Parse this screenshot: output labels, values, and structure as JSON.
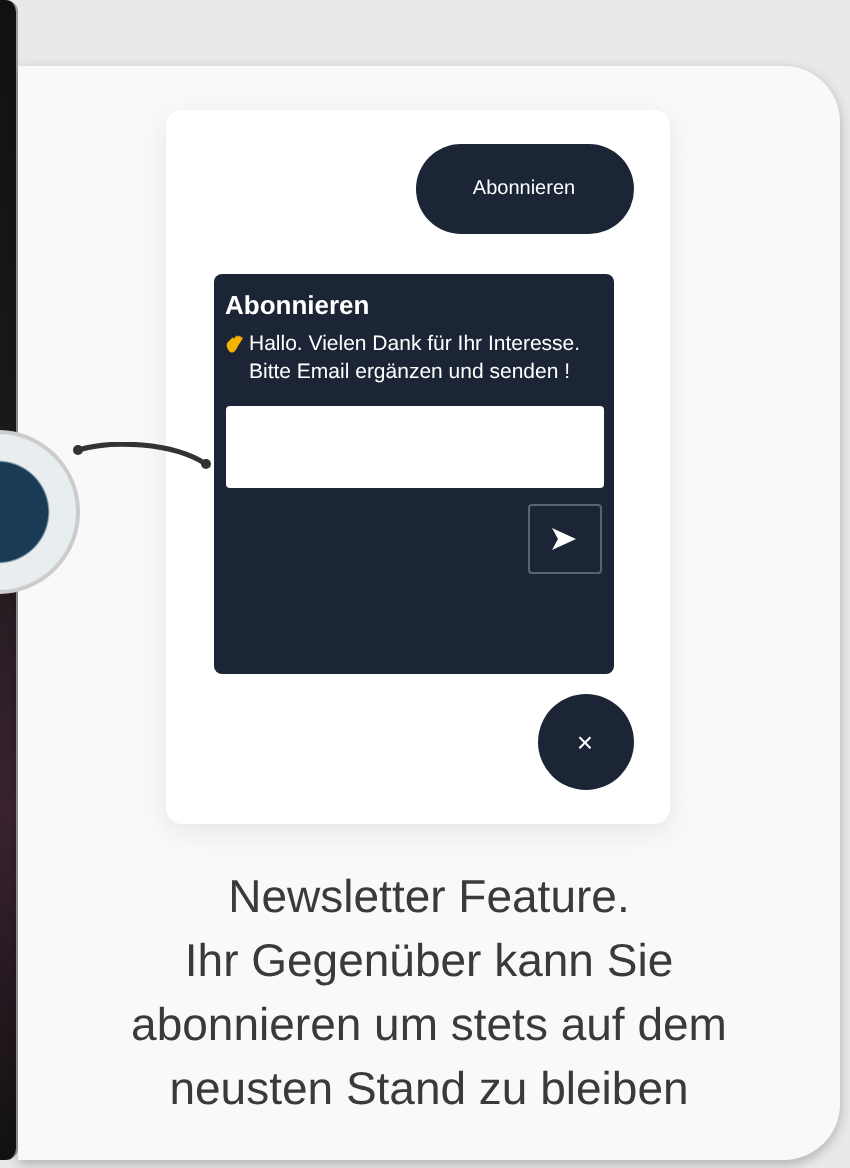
{
  "preview": {
    "subscribe_button": "Abonnieren",
    "popup": {
      "title": "Abonnieren",
      "message": "Hallo. Vielen Dank für Ihr Interesse. Bitte Email ergänzen und senden !"
    },
    "close_button": "×"
  },
  "caption": [
    "Newsletter Feature.",
    "Ihr Gegenüber kann Sie abonnieren um stets auf dem neusten Stand zu bleiben"
  ]
}
